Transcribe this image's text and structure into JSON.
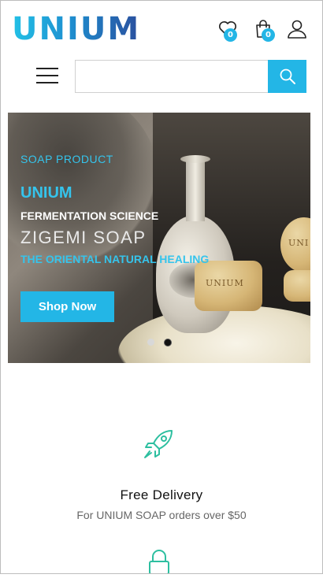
{
  "header": {
    "logo": "UNIUM",
    "wishlist_count": "0",
    "cart_count": "0"
  },
  "search": {
    "value": "",
    "placeholder": ""
  },
  "hero": {
    "subtitle": "SOAP PRODUCT",
    "brand": "UNIUM",
    "line1": "FERMENTATION SCIENCE",
    "line2": "ZIGEMI SOAP",
    "line3": "THE ORIENTAL NATURAL HEALING",
    "cta": "Shop Now",
    "soap_label_1": "UNIUM",
    "soap_label_2": "UNI",
    "slides_total": 2,
    "active_slide": 2
  },
  "features": [
    {
      "icon": "rocket-icon",
      "title": "Free Delivery",
      "description": "For UNIUM SOAP orders over $50"
    },
    {
      "icon": "lock-icon"
    }
  ],
  "colors": {
    "accent": "#23b6e6",
    "text": "#111111",
    "muted": "#666666"
  }
}
